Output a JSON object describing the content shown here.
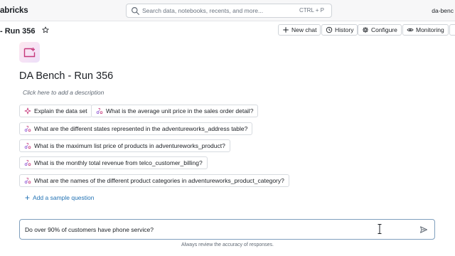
{
  "topbar": {
    "brand": "abricks",
    "search_placeholder": "Search data, notebooks, recents, and more...",
    "search_shortcut": "CTRL + P",
    "workspace": "da-benc"
  },
  "header": {
    "title": "- Run 356",
    "buttons": {
      "new_chat": "New chat",
      "history": "History",
      "configure": "Configure",
      "monitoring": "Monitoring"
    }
  },
  "room": {
    "title": "DA Bench - Run 356",
    "description_placeholder": "Click here to add a description"
  },
  "sample_questions": [
    "Explain the data set",
    "What is the average unit price in the sales order detail?",
    "What are the different states represented in the adventureworks_address table?",
    "What is the maximum list price of products in adventureworks_product?",
    "What is the monthly total revenue from telco_customer_billing?",
    "What are the names of the different product categories in adventureworks_product_category?"
  ],
  "add_sample_label": "Add a sample question",
  "chat": {
    "input_value": "Do over 90% of customers have phone service?"
  },
  "disclaimer": "Always review the accuracy of responses.",
  "colors": {
    "accent_blue": "#2272b4",
    "icon_pink": "#c6377a",
    "icon_purple": "#8a4fd1"
  },
  "icons": {
    "search": "search-icon",
    "star": "star-icon",
    "plus": "plus-icon",
    "history": "history-icon",
    "configure": "gear-icon",
    "monitoring": "eye-icon",
    "sparkle": "sparkle-icon",
    "question": "genie-question-icon",
    "send": "send-icon"
  }
}
